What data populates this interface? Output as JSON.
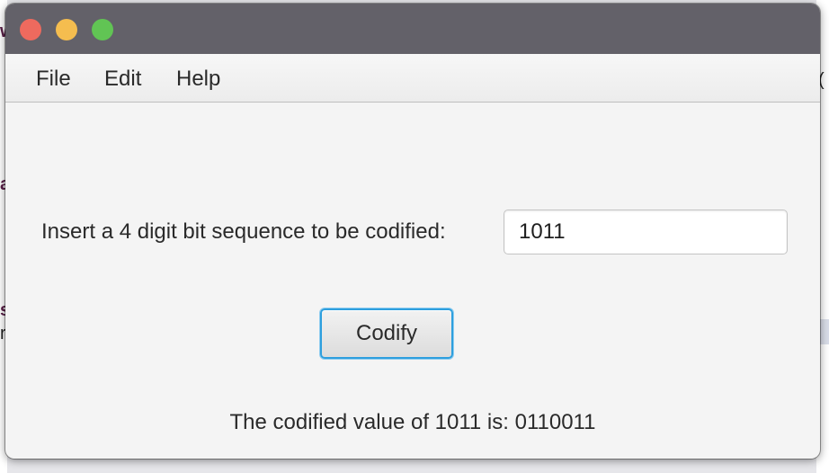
{
  "background": {
    "glyphs": [
      "w",
      "a",
      "s",
      "r",
      "("
    ]
  },
  "window": {
    "controls": {
      "close_color": "#ee6a5e",
      "minimize_color": "#f5bd4f",
      "maximize_color": "#61c454"
    }
  },
  "menubar": {
    "items": [
      {
        "label": "File"
      },
      {
        "label": "Edit"
      },
      {
        "label": "Help"
      }
    ]
  },
  "form": {
    "prompt": "Insert a 4 digit bit sequence to be codified:",
    "input_value": "1011",
    "button_label": "Codify",
    "result_text": "The codified value of 1011 is: 0110011"
  },
  "colors": {
    "titlebar": "#636169",
    "focus_ring": "#2e9fde",
    "window_bg": "#f4f4f4"
  }
}
